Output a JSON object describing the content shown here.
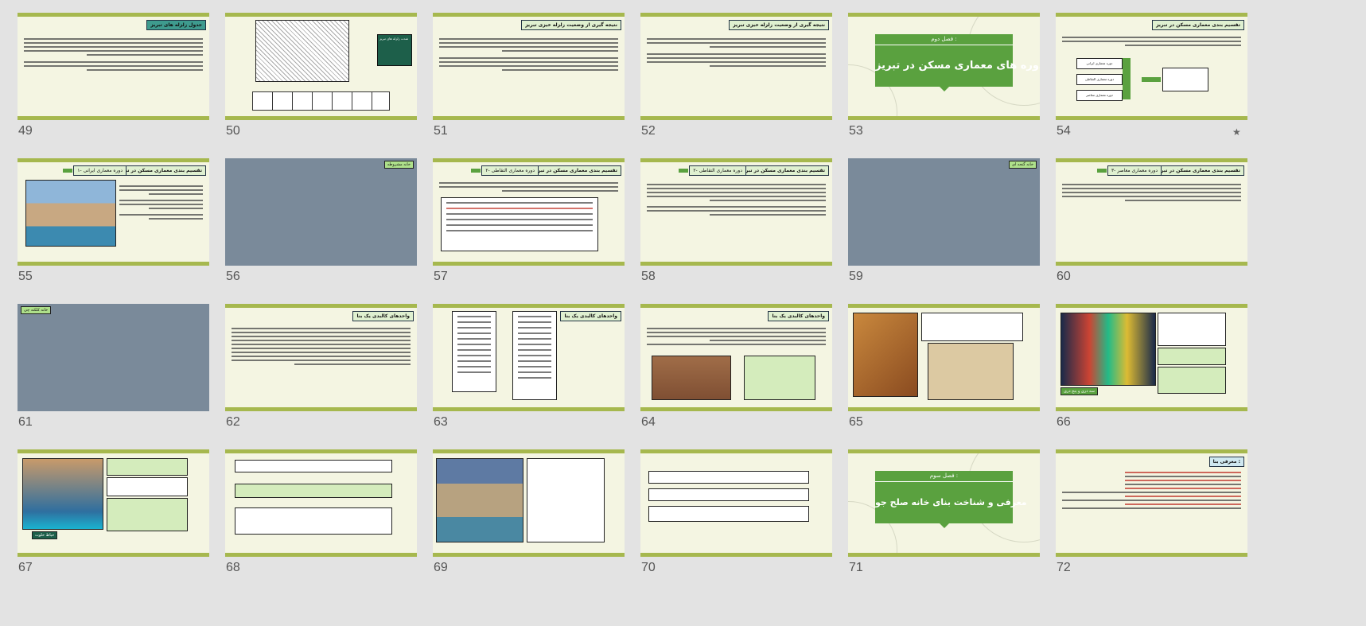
{
  "slides": [
    {
      "number": "49",
      "title": "جدول زلزله های تبریز"
    },
    {
      "number": "50",
      "note": "شدت زلزله های تبریز"
    },
    {
      "number": "51",
      "title": "نتیجه گیری از وضعیت زلزله خیزی تبریز"
    },
    {
      "number": "52",
      "title": "نتیجه گیری از وضعیت زلزله خیزی تبریز"
    },
    {
      "number": "53",
      "chapter_label": "فصل دوم :",
      "chapter_title": "دوره های معماری مسکن در تبریز"
    },
    {
      "number": "54",
      "title": "تقسیم بندی معماری مسکن در تبریز",
      "items": [
        "دوره معماری ایرانی",
        "دوره معماری التقاطی",
        "دوره معماری معاصر"
      ],
      "starred": true
    },
    {
      "number": "55",
      "title": "تقسیم بندی معماری مسکن در تبریز",
      "subtitle": "۱- دوره معماری ایرانی"
    },
    {
      "number": "56",
      "caption": "خانه مشروطه"
    },
    {
      "number": "57",
      "title": "تقسیم بندی معماری مسکن در تبریز",
      "subtitle": "۲- دوره معماری التقاطی"
    },
    {
      "number": "58",
      "title": "تقسیم بندی معماری مسکن در تبریز",
      "subtitle": "۲- دوره معماری التقاطی"
    },
    {
      "number": "59",
      "caption": "خانه گنجه ای"
    },
    {
      "number": "60",
      "title": "تقسیم بندی معماری مسکن در تبریز",
      "subtitle": "۳- دوره معماری معاصر"
    },
    {
      "number": "61",
      "caption": "خانه کلکته چی"
    },
    {
      "number": "62",
      "title": "واحدهای کالبدی یک بنا"
    },
    {
      "number": "63",
      "title": "واحدهای کالبدی یک بنا"
    },
    {
      "number": "64",
      "title": "واحدهای کالبدی یک بنا"
    },
    {
      "number": "65"
    },
    {
      "number": "66",
      "caption": "سه دری و پنج دری"
    },
    {
      "number": "67",
      "caption": "حیاط خلوت"
    },
    {
      "number": "68"
    },
    {
      "number": "69"
    },
    {
      "number": "70"
    },
    {
      "number": "71",
      "chapter_label": "فصل سوم :",
      "chapter_title": "معرفی و شناخت بنای خانه صلح جو"
    },
    {
      "number": "72",
      "title": "معرفی بنا :"
    }
  ],
  "colors": {
    "accent_green": "#5aa13f",
    "band": "#a6b84e",
    "slide_bg": "#f4f5e2",
    "teal": "#3e9b8e"
  },
  "icons": {
    "favorite": "star-icon"
  }
}
